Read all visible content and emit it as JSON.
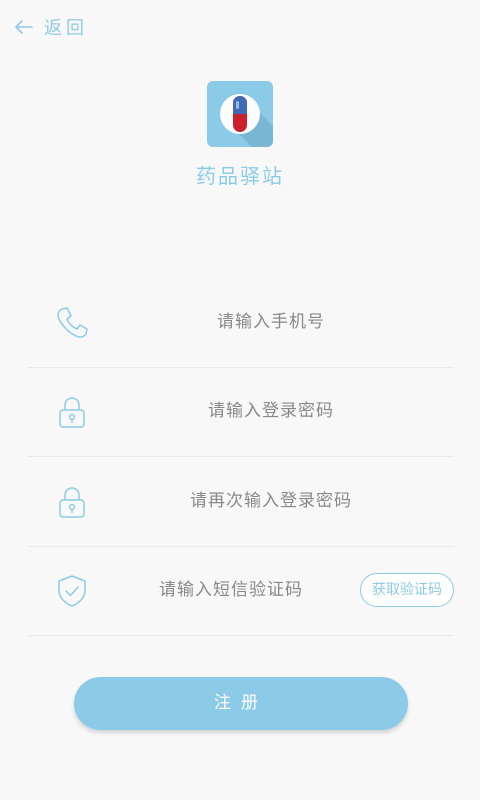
{
  "header": {
    "back_label": "返回"
  },
  "app": {
    "name": "药品驿站"
  },
  "form": {
    "phone_placeholder": "请输入手机号",
    "password_placeholder": "请输入登录密码",
    "confirm_placeholder": "请再次输入登录密码",
    "sms_placeholder": "请输入短信验证码",
    "get_code_label": "获取验证码"
  },
  "register_label": "注册",
  "colors": {
    "accent": "#8ccbe7",
    "capsule_red": "#cc1f2b",
    "capsule_blue": "#3f6bb4"
  }
}
